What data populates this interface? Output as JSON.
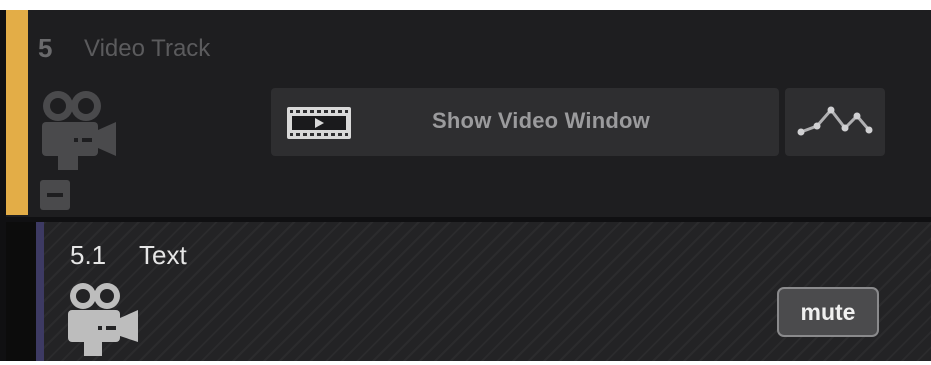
{
  "track": {
    "number": "5",
    "name": "Video Track",
    "color": "#e3ad47",
    "icon": "video-camera-icon",
    "collapse_icon": "minus-icon",
    "show_video_window": {
      "label": "Show Video Window",
      "icon": "film-strip-icon"
    },
    "automation": {
      "icon": "automation-curve-icon"
    }
  },
  "subtrack": {
    "number": "5.1",
    "name": "Text",
    "color": "#3d3a63",
    "icon": "video-camera-icon",
    "mute_label": "mute"
  }
}
